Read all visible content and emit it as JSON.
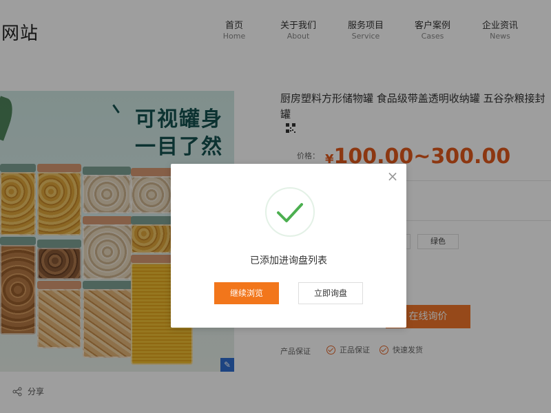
{
  "site": {
    "title": "网站"
  },
  "nav": {
    "items": [
      {
        "cn": "首页",
        "en": "Home"
      },
      {
        "cn": "关于我们",
        "en": "About"
      },
      {
        "cn": "服务项目",
        "en": "Service"
      },
      {
        "cn": "客户案例",
        "en": "Cases"
      },
      {
        "cn": "企业资讯",
        "en": "News"
      }
    ]
  },
  "product": {
    "image_slogan_line1": "可视罐身",
    "image_slogan_line2": "一目了然",
    "title": "厨房塑料方形储物罐 食品级带盖透明收纳罐 五谷杂粮接封罐",
    "price_label": "价格：",
    "price_currency": "¥",
    "price_range": "100.00~300.00",
    "color_option": "绿色",
    "inquiry_button": "在线询价",
    "guarantee_label": "产品保证",
    "guarantees": [
      "正品保证",
      "快速发货"
    ],
    "share_label": "分享"
  },
  "modal": {
    "message": "已添加进询盘列表",
    "continue_button": "继续浏览",
    "inquire_button": "立即询盘",
    "close_symbol": "×"
  },
  "colors": {
    "accent": "#f2761b",
    "price": "#e25a1c",
    "success": "#4caf50"
  },
  "icons": {
    "close": "close-icon",
    "success": "check-icon",
    "share": "share-icon",
    "qr": "qr-code-icon",
    "edit": "edit-icon"
  }
}
